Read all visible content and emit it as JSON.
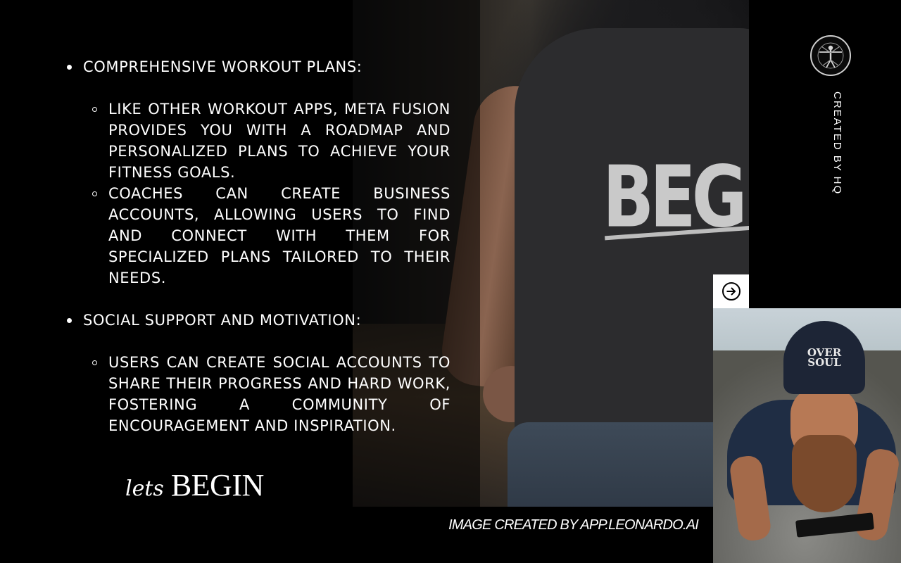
{
  "content": {
    "sections": [
      {
        "heading": "COMPREHENSIVE WORKOUT PLANS:",
        "items": [
          "LIKE OTHER WORKOUT APPS, META FUSION PROVIDES YOU WITH A ROADMAP AND PERSONALIZED PLANS TO ACHIEVE YOUR FITNESS GOALS.",
          "COACHES CAN CREATE BUSINESS ACCOUNTS, ALLOWING USERS TO FIND AND CONNECT WITH THEM FOR SPECIALIZED PLANS TAILORED TO THEIR NEEDS."
        ]
      },
      {
        "heading": "SOCIAL SUPPORT AND MOTIVATION:",
        "items": [
          "USERS CAN CREATE SOCIAL ACCOUNTS TO SHARE THEIR PROGRESS AND HARD WORK, FOSTERING A COMMUNITY OF ENCOURAGEMENT AND INSPIRATION."
        ]
      }
    ]
  },
  "cta": {
    "script": "lets",
    "word": "BEGIN"
  },
  "credits": {
    "vertical": "CREATED BY HQ",
    "image": "IMAGE CREATED BY APP.LEONARDO.AI"
  },
  "photos": {
    "shirt_text": "BEGIN",
    "beanie_text": "OVER SOUL"
  },
  "icons": {
    "logo": "vitruvian-man-logo-icon",
    "next": "arrow-right-circle-icon"
  },
  "colors": {
    "background": "#000000",
    "text": "#ffffff",
    "button": "#ffffff"
  }
}
